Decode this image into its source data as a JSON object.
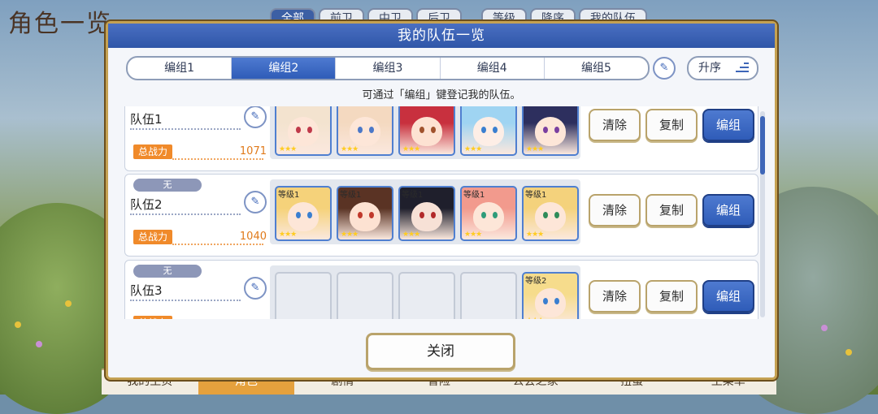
{
  "background": {
    "screen_title": "角色一览",
    "filter_tabs": [
      "全部",
      "前卫",
      "中卫",
      "后卫",
      "等级",
      "降序",
      "我的队伍"
    ],
    "bottom_nav": [
      "我的主页",
      "角色",
      "剧情",
      "冒险",
      "公会之家",
      "扭蛋",
      "主菜单"
    ]
  },
  "modal": {
    "title": "我的队伍一览",
    "tabs": [
      "编组1",
      "编组2",
      "编组3",
      "编组4",
      "编组5"
    ],
    "active_tab": "编组2",
    "sort_label": "升序",
    "hint": "可通过「编组」键登记我的队伍。",
    "close_label": "关闭"
  },
  "parties": [
    {
      "badge": "",
      "name": "队伍1",
      "power_label": "总战力",
      "power": "1071",
      "slots": [
        {
          "level": "",
          "hair": "#f3e3cf",
          "skin": "#fde6d8",
          "eye": "#c0394a",
          "stars": "★★★"
        },
        {
          "level": "",
          "hair": "#f4d9c0",
          "skin": "#fde6d8",
          "eye": "#4c78c8",
          "stars": "★★★"
        },
        {
          "level": "",
          "hair": "#c8303e",
          "skin": "#fde2d2",
          "eye": "#a0522d",
          "stars": "★★★"
        },
        {
          "level": "",
          "hair": "#9fd4f2",
          "skin": "#fdeee6",
          "eye": "#3a7fd0",
          "stars": "★★★"
        },
        {
          "level": "",
          "hair": "#2d2f5e",
          "skin": "#fde6d8",
          "eye": "#7a3fa0",
          "stars": "★★★"
        }
      ],
      "buttons": {
        "clear": "清除",
        "copy": "复制",
        "edit": "编组"
      }
    },
    {
      "badge": "无",
      "name": "队伍2",
      "power_label": "总战力",
      "power": "1040",
      "slots": [
        {
          "level": "等级1",
          "hair": "#f5d27a",
          "skin": "#fde6d8",
          "eye": "#3a7fd0",
          "stars": "★★★"
        },
        {
          "level": "等级1",
          "hair": "#5a3324",
          "skin": "#fde2d2",
          "eye": "#c0392b",
          "stars": "★★★"
        },
        {
          "level": "等级1",
          "hair": "#1f1f2c",
          "skin": "#f7e1d6",
          "eye": "#b22a2a",
          "stars": "★★★"
        },
        {
          "level": "等级1",
          "hair": "#f29a8d",
          "skin": "#fde6d8",
          "eye": "#2f9c7a",
          "stars": "★★★"
        },
        {
          "level": "等级1",
          "hair": "#f4d27c",
          "skin": "#fde6d8",
          "eye": "#2f8c5a",
          "stars": "★★★"
        }
      ],
      "buttons": {
        "clear": "清除",
        "copy": "复制",
        "edit": "编组"
      }
    },
    {
      "badge": "无",
      "name": "队伍3",
      "power_label": "总战力",
      "power": "",
      "slots": [
        {
          "empty": true
        },
        {
          "empty": true
        },
        {
          "empty": true
        },
        {
          "empty": true
        },
        {
          "level": "等级2",
          "hair": "#f6dc8c",
          "skin": "#fde6d8",
          "eye": "#3a7fd0",
          "stars": "★★★"
        }
      ],
      "buttons": {
        "clear": "清除",
        "copy": "复制",
        "edit": "编组"
      }
    }
  ]
}
